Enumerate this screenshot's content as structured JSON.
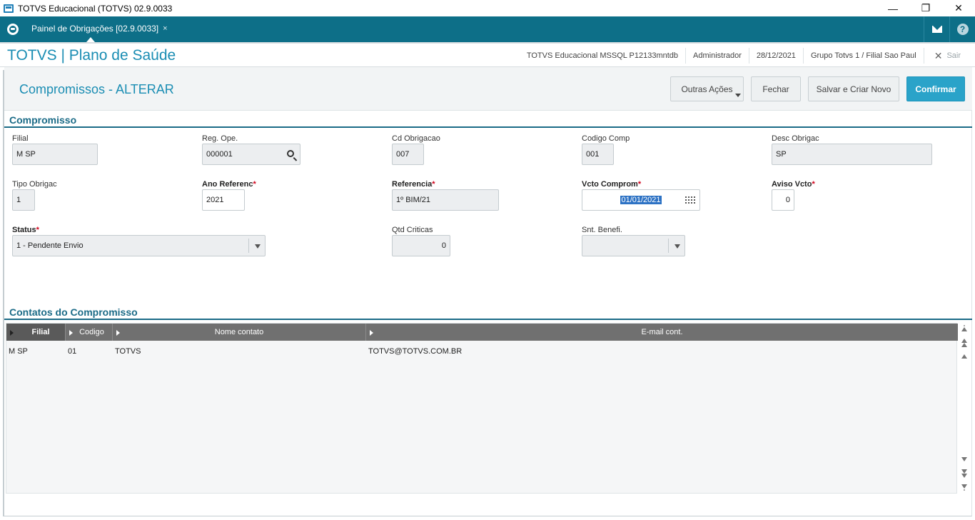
{
  "window": {
    "title": "TOTVS Educacional (TOTVS) 02.9.0033",
    "minimize": "—",
    "maximize": "❐",
    "close": "✕"
  },
  "tabbar": {
    "tab_label": "Painel de Obrigações [02.9.0033]",
    "tab_close": "×",
    "help": "?"
  },
  "header": {
    "brand": "TOTVS | Plano de Saúde",
    "environment": "TOTVS Educacional MSSQL P12133mntdb",
    "user": "Administrador",
    "date": "28/12/2021",
    "branch": "Grupo Totvs 1 / Filial Sao Paul",
    "exit_label": "Sair"
  },
  "page": {
    "title": "Compromissos - ALTERAR",
    "buttons": {
      "more_actions": "Outras Ações",
      "close": "Fechar",
      "save_new": "Salvar e Criar Novo",
      "confirm": "Confirmar"
    }
  },
  "form": {
    "section_title": "Compromisso",
    "filial": {
      "label": "Filial",
      "value": "M SP"
    },
    "reg_ope": {
      "label": "Reg. Ope.",
      "value": "000001"
    },
    "cd_obrigacao": {
      "label": "Cd Obrigacao",
      "value": "007"
    },
    "codigo_comp": {
      "label": "Codigo Comp",
      "value": "001"
    },
    "desc_obrigac": {
      "label": "Desc Obrigac",
      "value": "SP"
    },
    "tipo_obrigac": {
      "label": "Tipo Obrigac",
      "value": "1"
    },
    "ano_referenc": {
      "label": "Ano Referenc",
      "value": "2021",
      "required": "*"
    },
    "referencia": {
      "label": "Referencia",
      "value": "1º BIM/21",
      "required": "*"
    },
    "vcto_comprom": {
      "label": "Vcto Comprom",
      "value": "01/01/2021",
      "required": "*"
    },
    "aviso_vcto": {
      "label": "Aviso Vcto",
      "value": "0",
      "required": "*"
    },
    "status": {
      "label": "Status",
      "value": "1 - Pendente Envio",
      "required": "*"
    },
    "qtd_criticas": {
      "label": "Qtd Criticas",
      "value": "0"
    },
    "snt_benefi": {
      "label": "Snt. Benefi.",
      "value": ""
    }
  },
  "contacts": {
    "section_title": "Contatos do Compromisso",
    "columns": [
      "Filial",
      "Codigo",
      "Nome contato",
      "E-mail cont."
    ],
    "rows": [
      {
        "filial": "M SP",
        "codigo": "01",
        "nome": "TOTVS",
        "email": "TOTVS@TOTVS.COM.BR"
      }
    ]
  },
  "colors": {
    "brand": "#1a8db3",
    "tabbar": "#0d6f88",
    "section": "#1b6b87",
    "primary_button": "#2aa3c9",
    "required": "#d0021b"
  }
}
